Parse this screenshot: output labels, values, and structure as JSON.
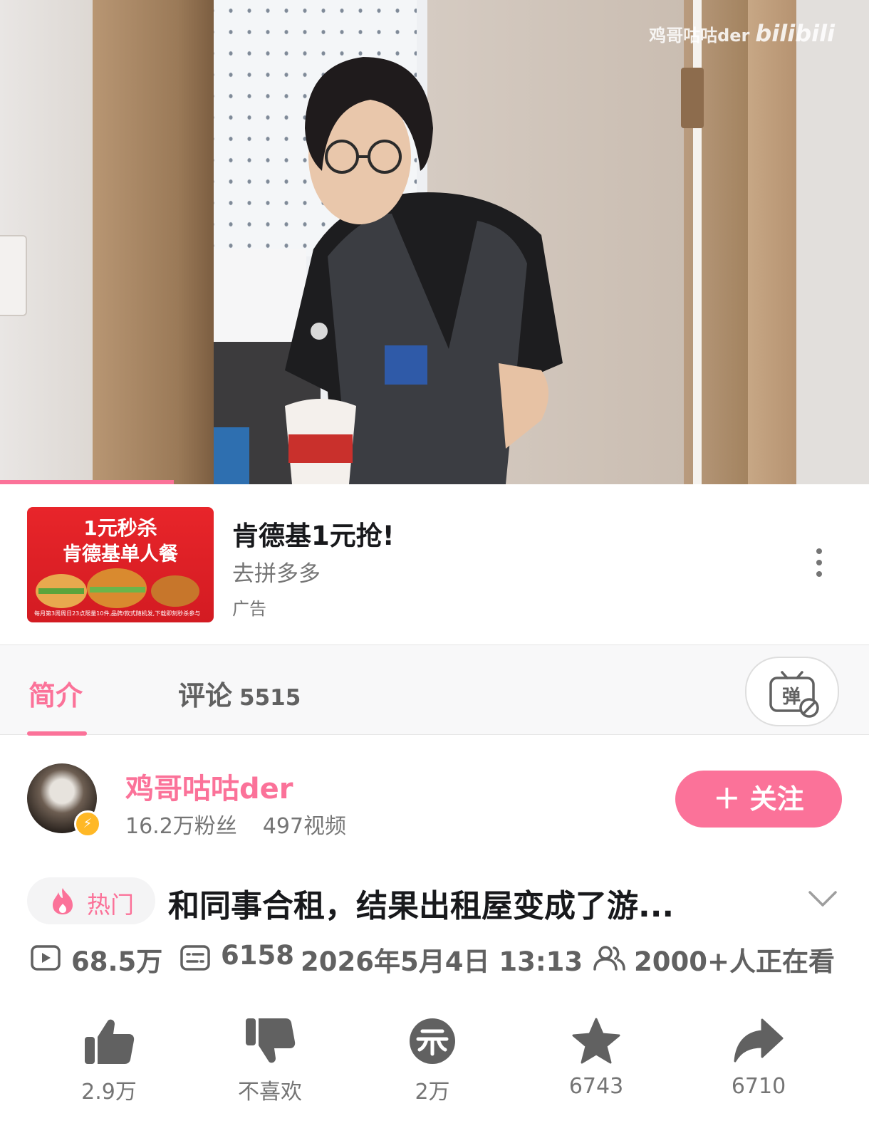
{
  "video": {
    "watermark_author": "鸡哥咕咕der",
    "watermark_logo": "bilibili",
    "progress": 0.2
  },
  "ad": {
    "image_line1": "1元秒杀",
    "image_line2": "肯德基单人餐",
    "image_fineprint": "每月第3周周日23点限量10件,品牌/款式随机发,下载即刻秒杀参与",
    "title": "肯德基1元抢!",
    "subtitle": "去拼多多",
    "tag": "广告",
    "more_icon": "more-vertical-icon"
  },
  "tabs": {
    "intro_label": "简介",
    "comments_label": "评论",
    "comments_count": "5515",
    "danmaku_icon": "danmaku-off-icon",
    "danmaku_glyph": "弹"
  },
  "uploader": {
    "name": "鸡哥咕咕der",
    "followers": "16.2万粉丝",
    "videos": "497视频",
    "follow_label": "＋ 关注",
    "badge_icon": "lightning-icon"
  },
  "title_row": {
    "hot_label": "热门",
    "title": "和同事合租，结果出租屋变成了游...",
    "expand_icon": "chevron-down-icon"
  },
  "meta": {
    "views": "68.5万",
    "danmaku_count": "6158",
    "date": "2026年5月4日 13:13",
    "watching": "2000+人正在看"
  },
  "actions": [
    {
      "icon": "thumbs-up-icon",
      "label": "2.9万"
    },
    {
      "icon": "thumbs-down-icon",
      "label": "不喜欢"
    },
    {
      "icon": "coin-icon",
      "label": "2万"
    },
    {
      "icon": "star-icon",
      "label": "6743"
    },
    {
      "icon": "share-icon",
      "label": "6710"
    }
  ],
  "colors": {
    "accent": "#fb7299",
    "text_primary": "#18191c",
    "text_secondary": "#757575",
    "icon_gray": "#616161"
  }
}
